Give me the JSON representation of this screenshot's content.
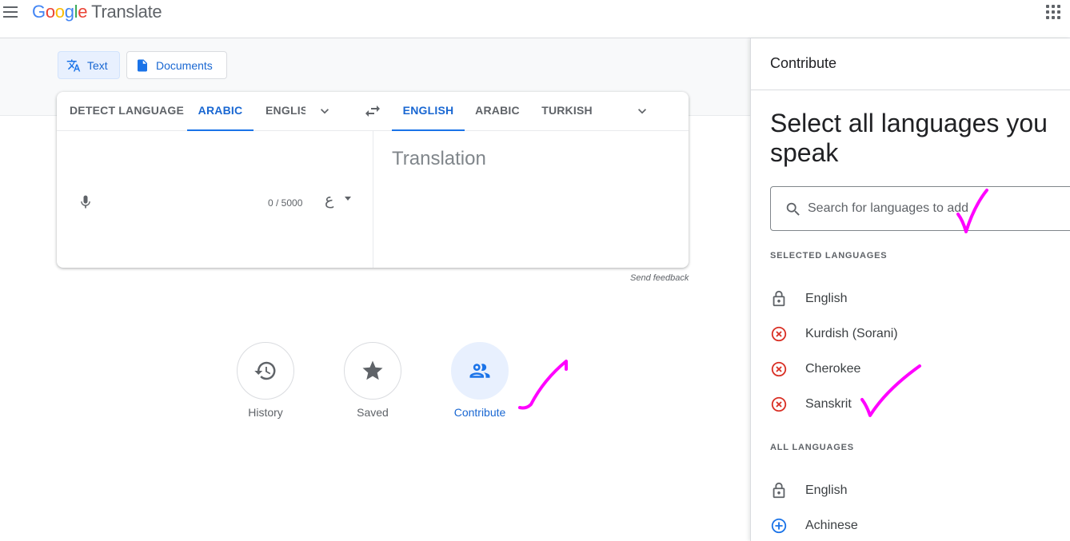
{
  "header": {
    "logo_letters": [
      "G",
      "o",
      "o",
      "g",
      "l",
      "e"
    ],
    "product": "Translate",
    "menu_icon": "hamburger-menu-icon",
    "apps_icon": "apps-grid-icon"
  },
  "modes": [
    {
      "label": "Text",
      "icon": "translate-icon",
      "active": true
    },
    {
      "label": "Documents",
      "icon": "document-icon",
      "active": false
    }
  ],
  "source_tabs": [
    "DETECT LANGUAGE",
    "ARABIC",
    "ENGLIS"
  ],
  "target_tabs": [
    "ENGLISH",
    "ARABIC",
    "TURKISH"
  ],
  "source_active": "ARABIC",
  "target_active": "ENGLISH",
  "source": {
    "char_count": "0 / 5000",
    "keyboard_glyph": "ع"
  },
  "target": {
    "placeholder": "Translation"
  },
  "send_feedback": "Send feedback",
  "shortcuts": [
    {
      "label": "History",
      "icon": "history-icon",
      "active": false
    },
    {
      "label": "Saved",
      "icon": "star-icon",
      "active": false
    },
    {
      "label": "Contribute",
      "icon": "contribute-people-icon",
      "active": true
    }
  ],
  "panel": {
    "title": "Contribute",
    "heading": "Select all languages you speak",
    "search_placeholder": "Search for languages to add",
    "selected_label": "SELECTED LANGUAGES",
    "selected": [
      {
        "name": "English",
        "icon": "lock-icon"
      },
      {
        "name": "Kurdish (Sorani)",
        "icon": "remove-circle-icon"
      },
      {
        "name": "Cherokee",
        "icon": "remove-circle-icon"
      },
      {
        "name": "Sanskrit",
        "icon": "remove-circle-icon"
      }
    ],
    "all_label": "ALL LANGUAGES",
    "all": [
      {
        "name": "English",
        "icon": "lock-icon"
      },
      {
        "name": "Achinese",
        "icon": "add-circle-icon"
      }
    ]
  },
  "colors": {
    "accent": "#1a73e8",
    "remove": "#d93025",
    "annotation": "#ff00ff"
  }
}
